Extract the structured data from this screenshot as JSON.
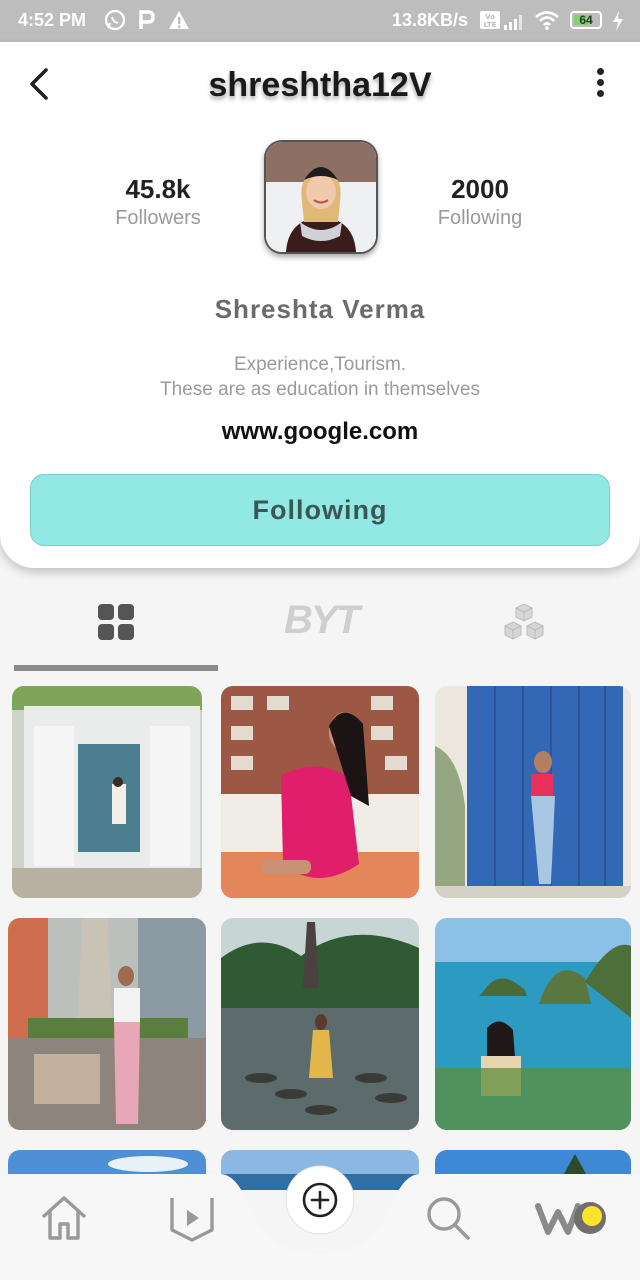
{
  "status_bar": {
    "time": "4:52 PM",
    "network_speed": "13.8KB/s",
    "volte": "Vo LTE",
    "battery": "64"
  },
  "profile": {
    "handle": "shreshtha12V",
    "followers_count": "45.8k",
    "followers_label": "Followers",
    "following_count": "2000",
    "following_label": "Following",
    "full_name": "Shreshta Verma",
    "bio_line1": "Experience,Tourism.",
    "bio_line2": "These are as education in themselves",
    "website": "www.google.com",
    "follow_button_label": "Following",
    "accent_color": "#92e8e4"
  },
  "tabs": {
    "items": [
      {
        "name": "grid",
        "icon": "grid-icon",
        "active": true
      },
      {
        "name": "byt",
        "label": "BYT",
        "active": false
      },
      {
        "name": "cubes",
        "icon": "cubes-icon",
        "active": false
      }
    ]
  },
  "posts": [
    {
      "subject": "white doorway with blue door"
    },
    {
      "subject": "pink dress by brick wall"
    },
    {
      "subject": "blue wooden gate"
    },
    {
      "subject": "statue terrace"
    },
    {
      "subject": "water garden stepping stones"
    },
    {
      "subject": "sea cliffs coast"
    },
    {
      "subject": "sky"
    },
    {
      "subject": "sea"
    },
    {
      "subject": "sky with palm"
    }
  ],
  "bottom_nav": {
    "items": [
      {
        "icon": "home-icon"
      },
      {
        "icon": "play-badge-icon"
      },
      {
        "icon": "add-icon"
      },
      {
        "icon": "search-icon"
      },
      {
        "icon": "wo-logo-icon",
        "label": "WO"
      }
    ]
  }
}
